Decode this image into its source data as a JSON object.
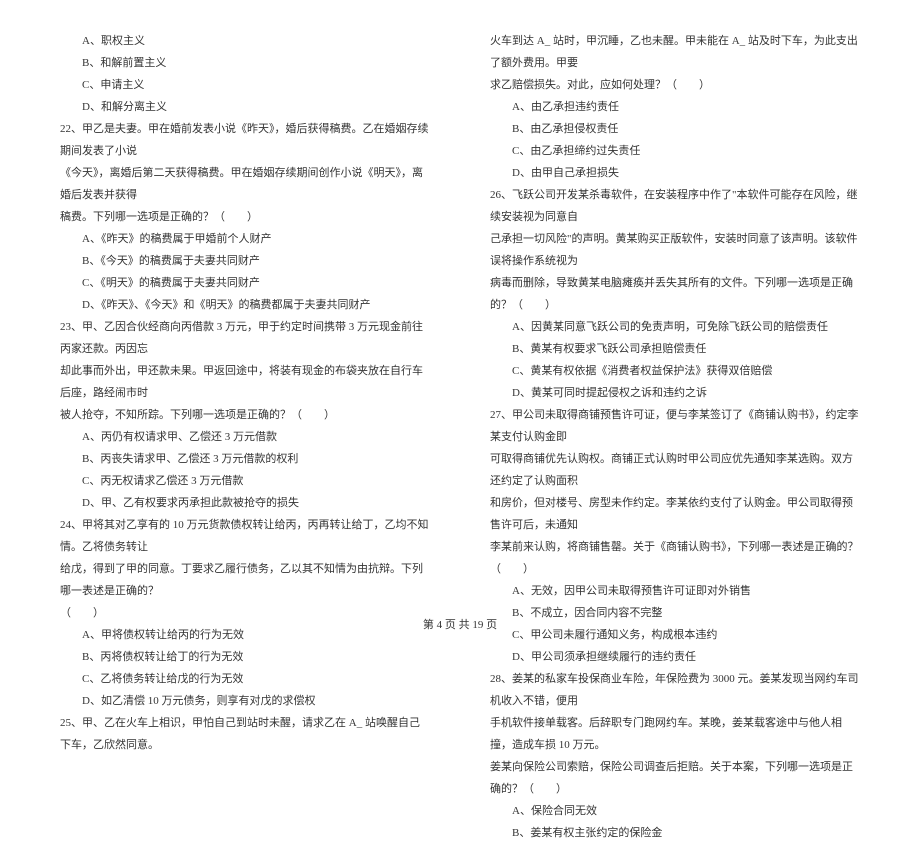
{
  "leftColumn": {
    "q21_opts": {
      "a": "A、职权主义",
      "b": "B、和解前置主义",
      "c": "C、申请主义",
      "d": "D、和解分离主义"
    },
    "q22": {
      "stem1": "22、甲乙是夫妻。甲在婚前发表小说《昨天》，婚后获得稿费。乙在婚姻存续期间发表了小说",
      "stem2": "《今天》，离婚后第二天获得稿费。甲在婚姻存续期间创作小说《明天》，离婚后发表并获得",
      "stem3": "稿费。下列哪一选项是正确的？（　　）",
      "a": "A、《昨天》的稿费属于甲婚前个人财产",
      "b": "B、《今天》的稿费属于夫妻共同财产",
      "c": "C、《明天》的稿费属于夫妻共同财产",
      "d": "D、《昨天》、《今天》和《明天》的稿费都属于夫妻共同财产"
    },
    "q23": {
      "stem1": "23、甲、乙因合伙经商向丙借款 3 万元，甲于约定时间携带 3 万元现金前往丙家还款。丙因忘",
      "stem2": "却此事而外出，甲还款未果。甲返回途中，将装有现金的布袋夹放在自行车后座，路经闹市时",
      "stem3": "被人抢夺，不知所踪。下列哪一选项是正确的？（　　）",
      "a": "A、丙仍有权请求甲、乙偿还 3 万元借款",
      "b": "B、丙丧失请求甲、乙偿还 3 万元借款的权利",
      "c": "C、丙无权请求乙偿还 3 万元借款",
      "d": "D、甲、乙有权要求丙承担此款被抢夺的损失"
    },
    "q24": {
      "stem1": "24、甲将其对乙享有的 10 万元货款债权转让给丙，丙再转让给丁，乙均不知情。乙将债务转让",
      "stem2": "给戊，得到了甲的同意。丁要求乙履行债务，乙以其不知情为由抗辩。下列哪一表述是正确的？",
      "stem3": "（　　）",
      "a": "A、甲将债权转让给丙的行为无效",
      "b": "B、丙将债权转让给丁的行为无效",
      "c": "C、乙将债务转让给戊的行为无效",
      "d": "D、如乙清偿 10 万元债务，则享有对戊的求偿权"
    },
    "q25": {
      "stem1": "25、甲、乙在火车上相识，甲怕自己到站时未醒，请求乙在 A_ 站唤醒自己下车，乙欣然同意。"
    }
  },
  "rightColumn": {
    "q25_cont": {
      "stem2": "火车到达 A_ 站时，甲沉睡，乙也未醒。甲未能在 A_ 站及时下车，为此支出了额外费用。甲要",
      "stem3": "求乙赔偿损失。对此，应如何处理？（　　）",
      "a": "A、由乙承担违约责任",
      "b": "B、由乙承担侵权责任",
      "c": "C、由乙承担缔约过失责任",
      "d": "D、由甲自己承担损失"
    },
    "q26": {
      "stem1": "26、飞跃公司开发某杀毒软件，在安装程序中作了\"本软件可能存在风险，继续安装视为同意自",
      "stem2": "己承担一切风险\"的声明。黄某购买正版软件，安装时同意了该声明。该软件误将操作系统视为",
      "stem3": "病毒而删除，导致黄某电脑瘫痪并丢失其所有的文件。下列哪一选项是正确的？（　　）",
      "a": "A、因黄某同意飞跃公司的免责声明，可免除飞跃公司的赔偿责任",
      "b": "B、黄某有权要求飞跃公司承担赔偿责任",
      "c": "C、黄某有权依据《消费者权益保护法》获得双倍赔偿",
      "d": "D、黄某可同时提起侵权之诉和违约之诉"
    },
    "q27": {
      "stem1": "27、甲公司未取得商铺预售许可证，便与李某签订了《商铺认购书》，约定李某支付认购金即",
      "stem2": "可取得商铺优先认购权。商铺正式认购时甲公司应优先通知李某选购。双方还约定了认购面积",
      "stem3": "和房价，但对楼号、房型未作约定。李某依约支付了认购金。甲公司取得预售许可后，未通知",
      "stem4": "李某前来认购，将商铺售罄。关于《商铺认购书》，下列哪一表述是正确的？（　　）",
      "a": "A、无效，因甲公司未取得预售许可证即对外销售",
      "b": "B、不成立，因合同内容不完整",
      "c": "C、甲公司未履行通知义务，构成根本违约",
      "d": "D、甲公司须承担继续履行的违约责任"
    },
    "q28": {
      "stem1": "28、姜某的私家车投保商业车险，年保险费为 3000 元。姜某发现当网约车司机收入不错，便用",
      "stem2": "手机软件接单载客。后辞职专门跑网约车。某晚，姜某载客途中与他人相撞，造成车损 10 万元。",
      "stem3": "姜某向保险公司索赔，保险公司调查后拒赔。关于本案，下列哪一选项是正确的？（　　）",
      "a": "A、保险合同无效",
      "b": "B、姜某有权主张约定的保险金"
    }
  },
  "footer": "第 4 页 共 19 页"
}
